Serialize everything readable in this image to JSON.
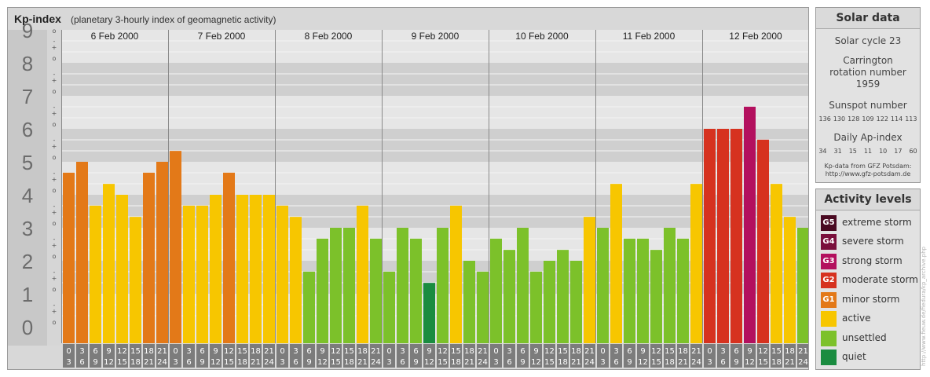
{
  "chart_data": {
    "type": "bar",
    "title": "Kp-index",
    "subtitle": "(planetary 3-hourly index of geomagnetic activity)",
    "ylim": [
      0,
      9
    ],
    "y_ticks": [
      "0",
      "1",
      "2",
      "3",
      "4",
      "5",
      "6",
      "7",
      "8",
      "9"
    ],
    "minor_tick_labels": [
      "o",
      "+",
      "-"
    ],
    "days": [
      "6 Feb 2000",
      "7 Feb 2000",
      "8 Feb 2000",
      "9 Feb 2000",
      "10 Feb 2000",
      "11 Feb 2000",
      "12 Feb 2000"
    ],
    "interval_start": [
      "0",
      "3",
      "6",
      "9",
      "12",
      "15",
      "18",
      "21"
    ],
    "interval_end": [
      "3",
      "6",
      "9",
      "12",
      "15",
      "18",
      "21",
      "24"
    ],
    "values": [
      4.67,
      5.0,
      3.67,
      4.33,
      4.0,
      3.33,
      4.67,
      5.0,
      5.33,
      3.67,
      3.67,
      4.0,
      4.67,
      4.0,
      4.0,
      4.0,
      3.67,
      3.33,
      1.67,
      2.67,
      3.0,
      3.0,
      3.67,
      2.67,
      1.67,
      3.0,
      2.67,
      1.33,
      3.0,
      3.67,
      2.0,
      1.67,
      2.67,
      2.33,
      3.0,
      1.67,
      2.0,
      2.33,
      2.0,
      3.33,
      3.0,
      4.33,
      2.67,
      2.67,
      2.33,
      3.0,
      2.67,
      4.33,
      6.0,
      6.0,
      6.0,
      6.67,
      5.67,
      4.33,
      3.33,
      3.0
    ],
    "level_colors": {
      "quiet": "#1a8c40",
      "unsettled": "#7cc12a",
      "active": "#f7c600",
      "G1": "#e37918",
      "G2": "#d6321f",
      "G3": "#b3105e",
      "G4": "#7a0f3c",
      "G5": "#4a0a22"
    }
  },
  "solar": {
    "title": "Solar data",
    "cycle": "Solar cycle 23",
    "carrington": "Carrington rotation number 1959",
    "sunspot_label": "Sunspot number",
    "sunspot_values": [
      "136",
      "130",
      "128",
      "109",
      "122",
      "114",
      "113"
    ],
    "ap_label": "Daily Ap-index",
    "ap_values": [
      "34",
      "31",
      "15",
      "11",
      "10",
      "17",
      "60"
    ],
    "credit_1": "Kp-data from GFZ Potsdam:",
    "credit_2": "http://www.gfz-potsdam.de"
  },
  "activity": {
    "title": "Activity levels",
    "levels": [
      {
        "code": "G5",
        "label": "extreme storm",
        "color": "#4a0a22"
      },
      {
        "code": "G4",
        "label": "severe storm",
        "color": "#7a0f3c"
      },
      {
        "code": "G3",
        "label": "strong storm",
        "color": "#b3105e"
      },
      {
        "code": "G2",
        "label": "moderate storm",
        "color": "#d6321f"
      },
      {
        "code": "G1",
        "label": "minor storm",
        "color": "#e37918"
      },
      {
        "code": "",
        "label": "active",
        "color": "#f7c600"
      },
      {
        "code": "",
        "label": "unsettled",
        "color": "#7cc12a"
      },
      {
        "code": "",
        "label": "quiet",
        "color": "#1a8c40"
      }
    ]
  },
  "watermark": "http://www.fieuw.de/fiedura/kp_archive.php"
}
